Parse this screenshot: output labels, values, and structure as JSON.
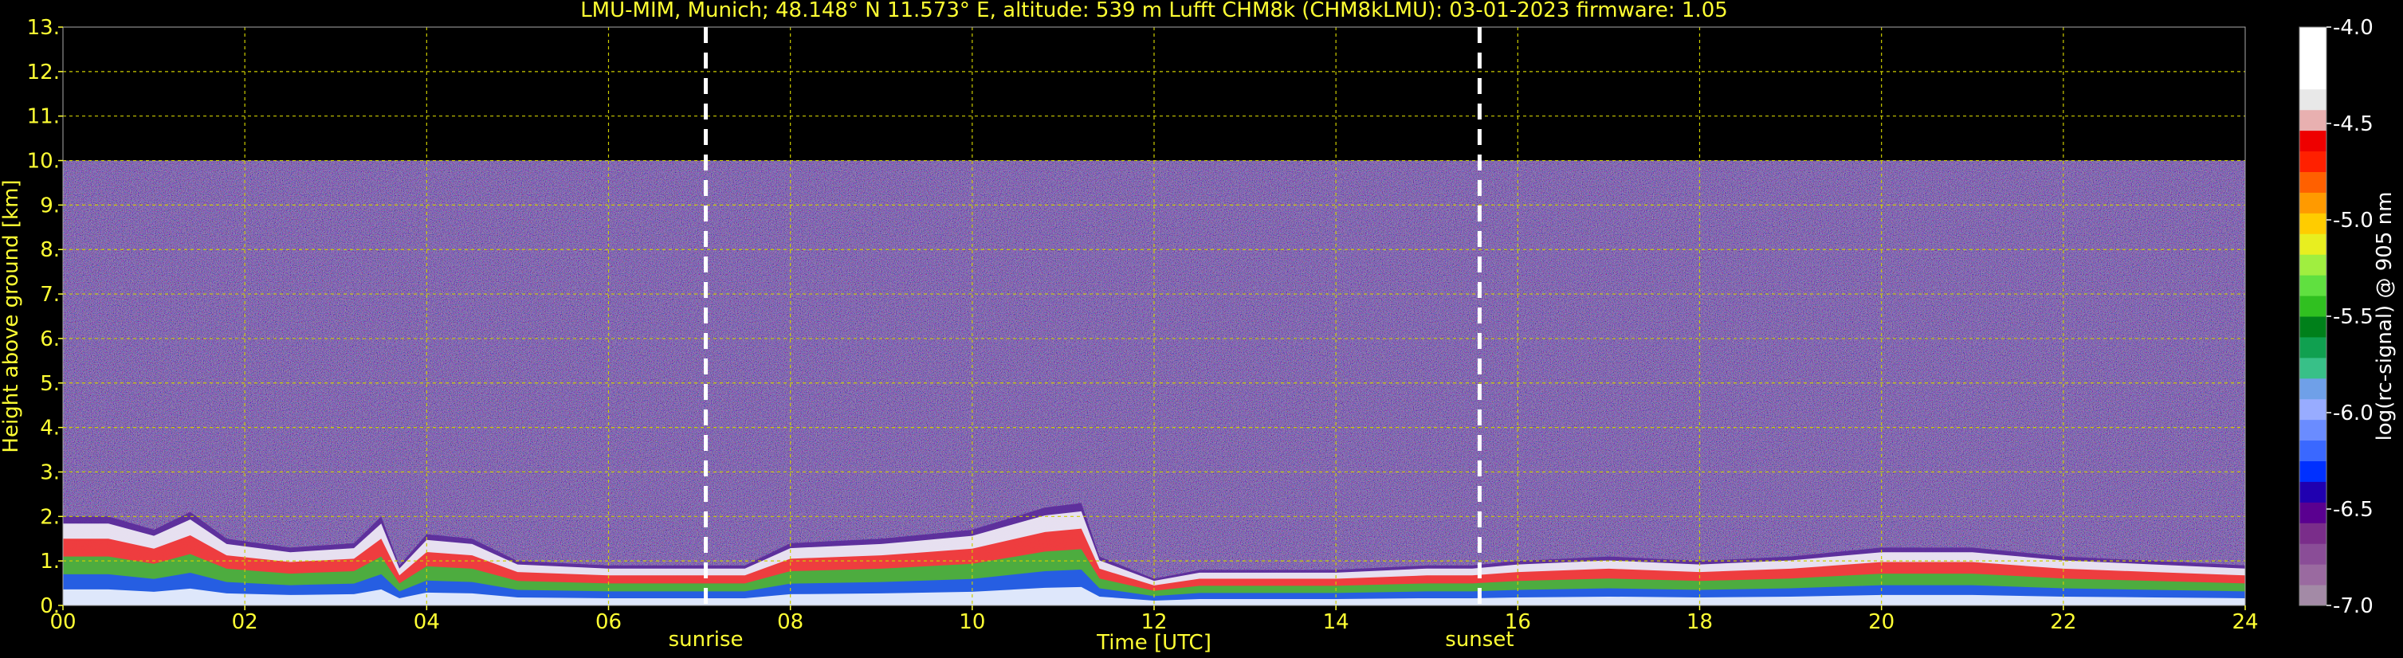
{
  "title": "LMU-MIM, Munich; 48.148° N 11.573° E, altitude: 539 m    Lufft CHM8k (CHM8kLMU): 03-01-2023    firmware: 1.05",
  "colors": {
    "background": "#000000",
    "text": "#ffff33",
    "grid": "#cccc00",
    "marker_line": "#ffffff",
    "noise_base": "#3c2e6e"
  },
  "chart_data": {
    "type": "heatmap",
    "title": "LMU-MIM, Munich; 48.148° N 11.573° E, altitude: 539 m    Lufft CHM8k (CHM8kLMU): 03-01-2023    firmware: 1.05",
    "xlabel": "Time [UTC]",
    "ylabel": "Height above ground [km]",
    "xlim": [
      0,
      24
    ],
    "ylim": [
      0,
      13
    ],
    "xticks": [
      "00",
      "02",
      "04",
      "06",
      "08",
      "10",
      "12",
      "14",
      "16",
      "18",
      "20",
      "22",
      "24"
    ],
    "yticks": [
      "0.",
      "1.",
      "2.",
      "3.",
      "4.",
      "5.",
      "6.",
      "7.",
      "8.",
      "9.",
      "10.",
      "11.",
      "12.",
      "13."
    ],
    "grid": true,
    "signal_ceiling_km": 10,
    "markers": [
      {
        "label": "sunrise",
        "time_utc": 7.07
      },
      {
        "label": "sunset",
        "time_utc": 15.58
      }
    ],
    "colorbar": {
      "label": "log(rc-signal) @ 905 nm",
      "range": [
        -7.0,
        -4.0
      ],
      "ticks": [
        "-4.0",
        "-4.5",
        "-5.0",
        "-5.5",
        "-6.0",
        "-6.5",
        "-7.0"
      ],
      "colors": [
        "#a38aa6",
        "#9a6aa0",
        "#8a4d97",
        "#7a2d8a",
        "#5a0090",
        "#2000b0",
        "#0030ff",
        "#3a68ff",
        "#6a8cff",
        "#98acff",
        "#6fa0e8",
        "#38c088",
        "#10a050",
        "#00801a",
        "#30c020",
        "#60e040",
        "#a0ee40",
        "#e8ee20",
        "#ffcc00",
        "#ff9a00",
        "#ff6000",
        "#ff2000",
        "#ee0000",
        "#e8b0b0",
        "#e8e8e8",
        "#ffffff",
        "#ffffff",
        "#ffffff"
      ]
    },
    "boundary_layer_top_km": [
      [
        0.0,
        2.0
      ],
      [
        0.5,
        2.0
      ],
      [
        1.0,
        1.7
      ],
      [
        1.4,
        2.1
      ],
      [
        1.8,
        1.5
      ],
      [
        2.5,
        1.3
      ],
      [
        3.2,
        1.4
      ],
      [
        3.5,
        2.0
      ],
      [
        3.7,
        0.9
      ],
      [
        4.0,
        1.6
      ],
      [
        4.5,
        1.5
      ],
      [
        5.0,
        1.0
      ],
      [
        6.0,
        0.9
      ],
      [
        7.0,
        0.9
      ],
      [
        7.5,
        0.9
      ],
      [
        8.0,
        1.4
      ],
      [
        9.0,
        1.5
      ],
      [
        10.0,
        1.7
      ],
      [
        10.8,
        2.2
      ],
      [
        11.2,
        2.3
      ],
      [
        11.4,
        1.1
      ],
      [
        12.0,
        0.6
      ],
      [
        12.5,
        0.8
      ],
      [
        13.0,
        0.8
      ],
      [
        14.0,
        0.8
      ],
      [
        15.0,
        0.9
      ],
      [
        15.5,
        0.9
      ],
      [
        16.0,
        1.0
      ],
      [
        17.0,
        1.1
      ],
      [
        18.0,
        1.0
      ],
      [
        19.0,
        1.1
      ],
      [
        20.0,
        1.3
      ],
      [
        21.0,
        1.3
      ],
      [
        22.0,
        1.1
      ],
      [
        23.0,
        1.0
      ],
      [
        24.0,
        0.9
      ]
    ]
  }
}
